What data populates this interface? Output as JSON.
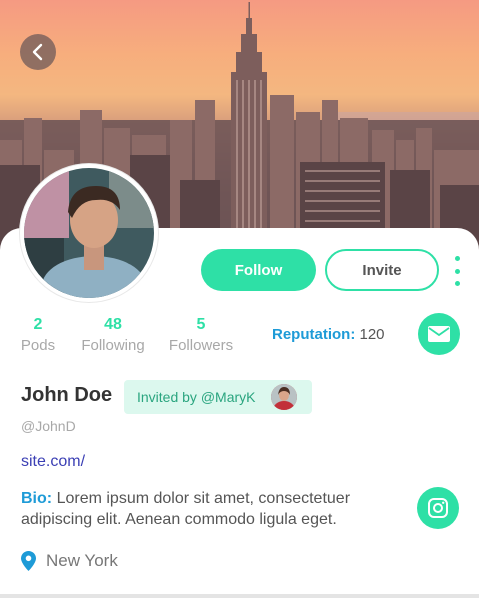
{
  "profile": {
    "name": "John Doe",
    "handle": "@JohnD",
    "invited_by": "Invited by @MaryK",
    "website": "site.com/",
    "bio_label": "Bio:",
    "bio": "Lorem ipsum dolor sit amet, consectetuer adipiscing elit. Aenean commodo ligula eget.",
    "location": "New York"
  },
  "actions": {
    "follow": "Follow",
    "invite": "Invite"
  },
  "stats": [
    {
      "value": "2",
      "label": "Pods"
    },
    {
      "value": "48",
      "label": "Following"
    },
    {
      "value": "5",
      "label": "Followers"
    }
  ],
  "reputation": {
    "label": "Reputation:",
    "value": "120"
  },
  "icons": {
    "back": "chevron-left-icon",
    "more": "more-vertical-icon",
    "mail": "envelope-icon",
    "instagram": "instagram-icon",
    "location": "map-pin-icon"
  },
  "colors": {
    "accent": "#2ee0a6",
    "link_blue": "#1e9bd7",
    "site_link": "#3b3fb4"
  }
}
